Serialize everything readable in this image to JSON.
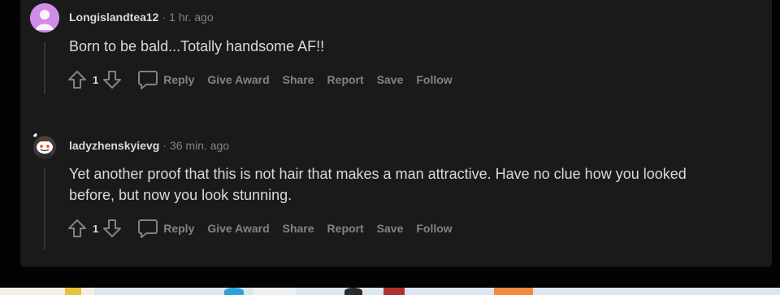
{
  "comments": [
    {
      "author": "Longislandtea12",
      "time": "1 hr. ago",
      "body": "Born to be bald...Totally handsome AF!!",
      "score": "1",
      "actions": {
        "reply": "Reply",
        "give_award": "Give Award",
        "share": "Share",
        "report": "Report",
        "save": "Save",
        "follow": "Follow"
      }
    },
    {
      "author": "ladyzhenskyievg",
      "time": "36 min. ago",
      "body": "Yet another proof that this is not hair that makes a man attractive. Have no clue how you looked before, but now you look stunning.",
      "score": "1",
      "actions": {
        "reply": "Reply",
        "give_award": "Give Award",
        "share": "Share",
        "report": "Report",
        "save": "Save",
        "follow": "Follow"
      }
    }
  ],
  "meta_separator": "·",
  "colors": {
    "background": "#030303",
    "panel": "#1a1a1b",
    "text": "#d7dadc",
    "muted": "#818384",
    "thread": "#343536"
  },
  "icons": [
    "upvote-icon",
    "downvote-icon",
    "comment-bubble-icon",
    "avatar-icon",
    "snoo-avatar-icon"
  ]
}
